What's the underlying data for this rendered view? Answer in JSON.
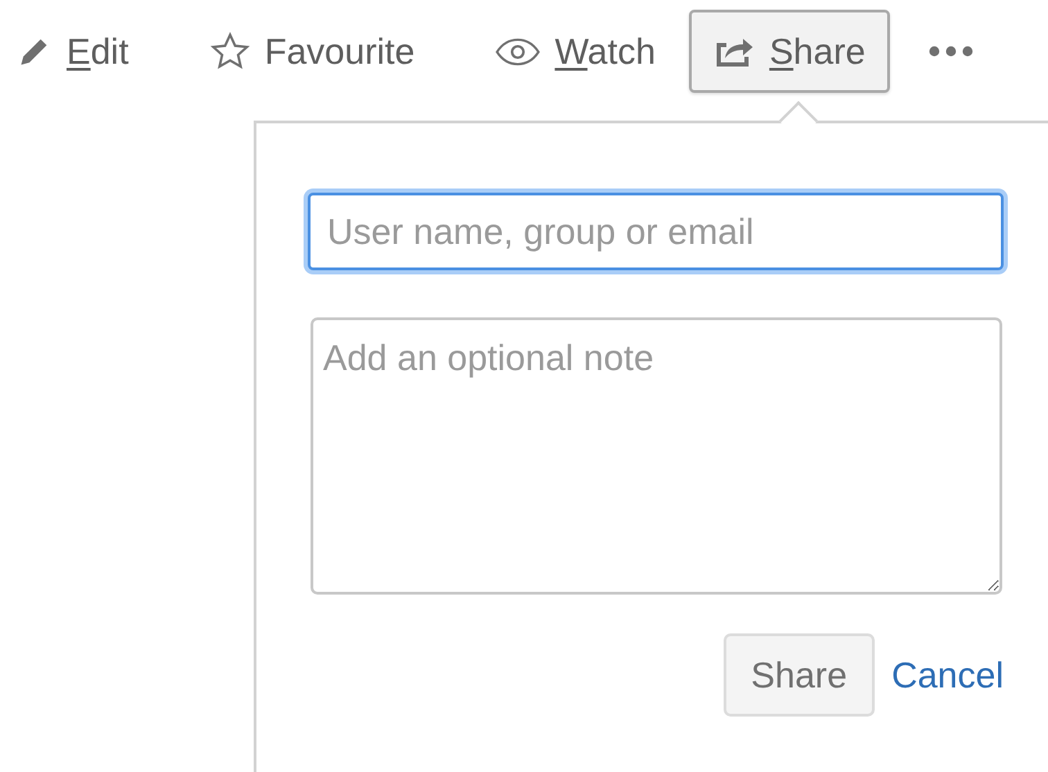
{
  "toolbar": [
    {
      "kind": "edit",
      "label": "Edit",
      "underline_first": true,
      "selected": false
    },
    {
      "kind": "favourite",
      "label": "Favourite",
      "underline_first": false,
      "selected": false
    },
    {
      "kind": "watch",
      "label": "Watch",
      "underline_first": true,
      "selected": false
    },
    {
      "kind": "share",
      "label": "Share",
      "underline_first": true,
      "selected": true
    },
    {
      "kind": "more",
      "selected": false
    }
  ],
  "share_dialog": {
    "recipient": {
      "placeholder": "User name, group or email",
      "focused": true
    },
    "note": {
      "placeholder": "Add an optional note"
    },
    "buttons": [
      {
        "kind": "button",
        "label": "Share"
      },
      {
        "kind": "link",
        "label": "Cancel"
      }
    ]
  }
}
